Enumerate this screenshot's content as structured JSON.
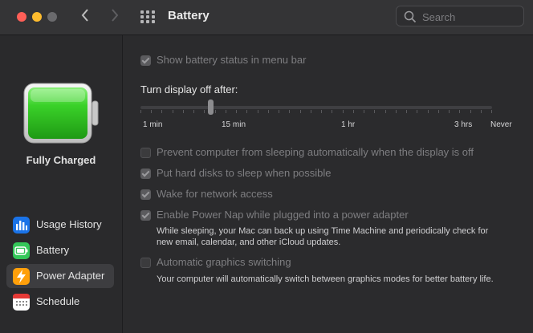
{
  "window": {
    "title": "Battery",
    "search_placeholder": "Search",
    "icons": {
      "back": "chevron-left-icon",
      "forward": "chevron-right-icon",
      "all_prefs": "grid-icon",
      "search": "magnifier-icon"
    }
  },
  "sidebar": {
    "charge_status": "Fully Charged",
    "items": [
      {
        "label": "Usage History",
        "icon": "bar-chart-icon",
        "icon_color": "#1a73e8"
      },
      {
        "label": "Battery",
        "icon": "battery-icon",
        "icon_color": "#34c759"
      },
      {
        "label": "Power Adapter",
        "icon": "lightning-icon",
        "icon_color": "#ff9f0a"
      },
      {
        "label": "Schedule",
        "icon": "calendar-icon",
        "icon_color": "#ffffff"
      }
    ],
    "selected": "Power Adapter"
  },
  "main": {
    "show_status": {
      "label": "Show battery status in menu bar",
      "checked": true,
      "enabled": false
    },
    "display_off": {
      "title": "Turn display off after:",
      "ticks": [
        "1 min",
        "15 min",
        "1 hr",
        "3 hrs",
        "Never"
      ],
      "value": "10 min"
    },
    "prevent_sleep": {
      "label": "Prevent computer from sleeping automatically when the display is off",
      "checked": false
    },
    "hard_disks": {
      "label": "Put hard disks to sleep when possible",
      "checked": true
    },
    "wake_network": {
      "label": "Wake for network access",
      "checked": true
    },
    "power_nap": {
      "label": "Enable Power Nap while plugged into a power adapter",
      "checked": true,
      "description_line1": "While sleeping, your Mac can back up using Time Machine and periodically check for",
      "description_line2": "new email, calendar, and other iCloud updates."
    },
    "graphics_switching": {
      "label": "Automatic graphics switching",
      "checked": false,
      "description": "Your computer will automatically switch between graphics modes for better battery life."
    }
  },
  "colors": {
    "battery_fill": "#3ad129",
    "accent": "#0a84ff"
  }
}
